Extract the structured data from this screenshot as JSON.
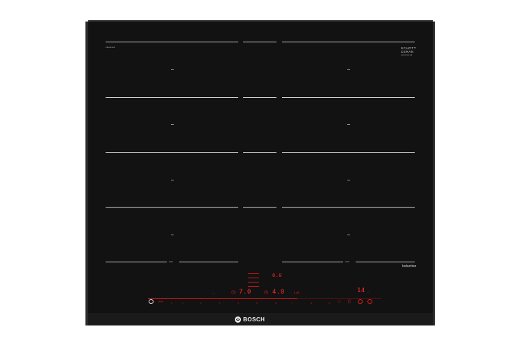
{
  "brand": {
    "logo_text": "BOSCH",
    "glass_brand_line1": "SCHOTT",
    "glass_brand_line2": "CERAN",
    "glass_brand_line3": "xxxxxxxx",
    "model_tag": "xxxxxxxx",
    "induction_label": "Induction",
    "flex_label_left": "xxxx",
    "flex_label_right": "xxxx"
  },
  "display": {
    "left_timer": "7.0",
    "center_level": "4.0",
    "right_timer": "14",
    "right_suffix": "‒",
    "top_readout": "0.0",
    "mode_icons": "8 88",
    "left_small": "‒‒"
  },
  "power_scale": [
    "0",
    "1",
    "2",
    "3",
    "4",
    "5",
    "6",
    "7",
    "8",
    "9"
  ],
  "colors": {
    "glass": "#121212",
    "zone_marks": "#cfcfcf",
    "led_red": "#ff2a2a"
  }
}
